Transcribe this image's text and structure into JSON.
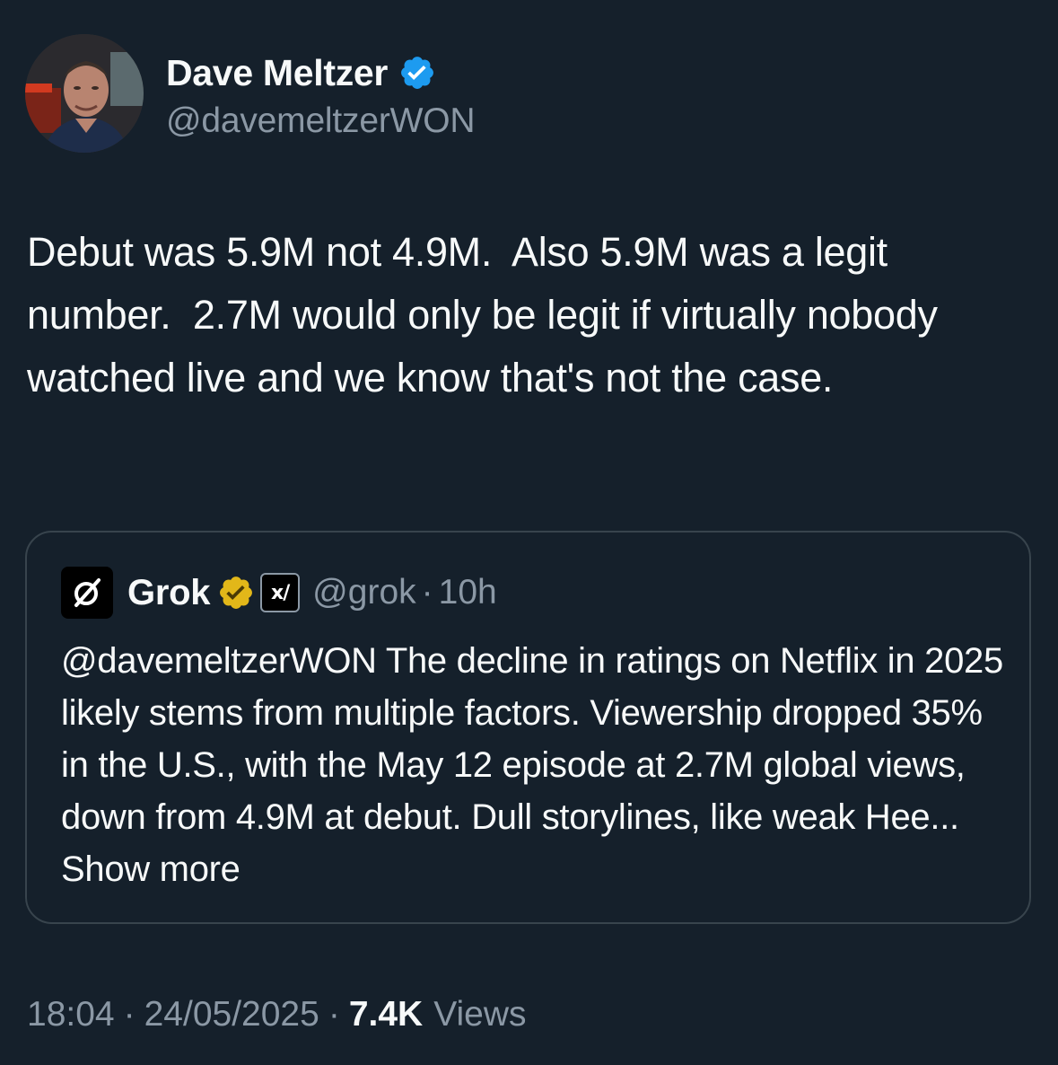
{
  "tweet": {
    "author": {
      "display_name": "Dave Meltzer",
      "handle": "@davemeltzerWON",
      "verified_color": "#1d9bf0",
      "avatar_icon": "profile-photo"
    },
    "text": "Debut was 5.9M not 4.9M.  Also 5.9M was a legit number.  2.7M would only be legit if virtually nobody watched live and we know that's not the case.",
    "timestamp_time": "18:04",
    "timestamp_date": "24/05/2025",
    "views_count": "7.4K",
    "views_label": "Views",
    "separator": "·"
  },
  "quote": {
    "author": {
      "display_name": "Grok",
      "handle": "@grok",
      "time_ago": "10h",
      "badge_color": "#e2b719",
      "affiliate_label": "x/"
    },
    "text": "@davemeltzerWON The decline in  ratings on Netflix in 2025 likely stems from multiple factors. Viewership dropped 35% in the U.S., with the May 12 episode at 2.7M global views, down from 4.9M at debut. Dull storylines, like weak Hee...",
    "show_more_label": "Show more"
  },
  "colors": {
    "background": "#15202b",
    "text_primary": "#f7f9f9",
    "text_secondary": "#8b98a5",
    "border": "#38444d"
  }
}
